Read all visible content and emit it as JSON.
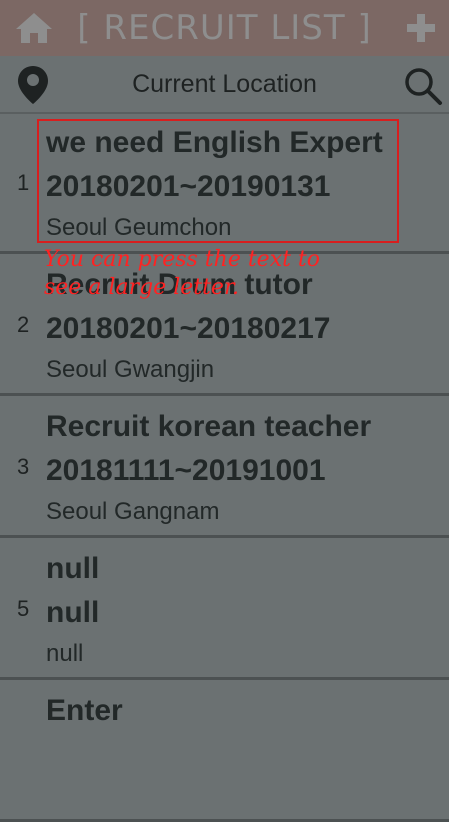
{
  "header": {
    "title": "[ RECRUIT LIST ]"
  },
  "location_bar": {
    "label": "Current Location"
  },
  "items": [
    {
      "num": "1",
      "title": "we need English Expert",
      "date": "20180201~20190131",
      "location": "Seoul Geumchon"
    },
    {
      "num": "2",
      "title": "Recruit Drum tutor",
      "date": "20180201~20180217",
      "location": "Seoul Gwangjin"
    },
    {
      "num": "3",
      "title": "Recruit korean teacher",
      "date": "20181111~20191001",
      "location": "Seoul Gangnam"
    },
    {
      "num": "5",
      "title": "null",
      "date": "null",
      "location": "null"
    },
    {
      "num": "",
      "title": "Enter",
      "date": "",
      "location": ""
    }
  ],
  "annotation": {
    "line1": "You can press the text to",
    "line2": "see a large letter."
  }
}
